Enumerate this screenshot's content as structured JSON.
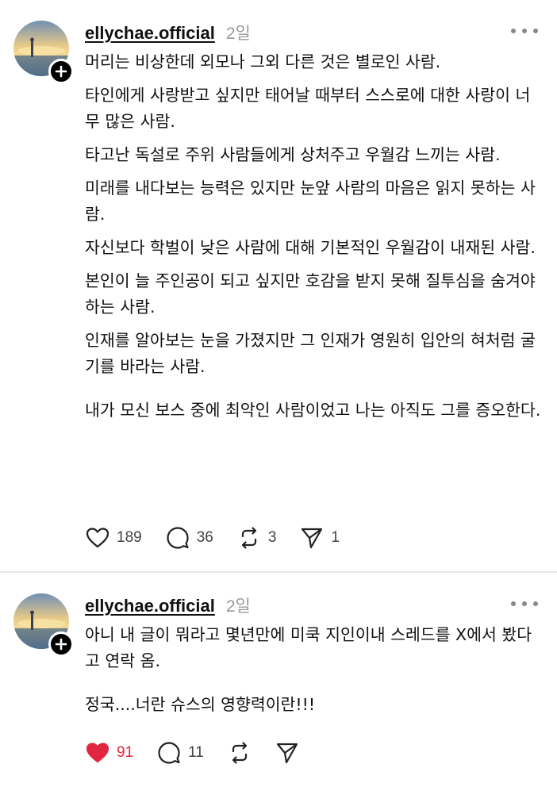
{
  "posts": [
    {
      "username": "ellychae.official",
      "time": "2일",
      "paragraphs": [
        "머리는 비상한데 외모나 그외 다른 것은 별로인 사람.",
        "타인에게 사랑받고 싶지만 태어날 때부터 스스로에 대한 사랑이 너무 많은 사람.",
        "타고난 독설로 주위 사람들에게 상처주고 우월감 느끼는 사람.",
        "미래를 내다보는 능력은 있지만 눈앞 사람의 마음은 읽지 못하는 사람.",
        "자신보다 학벌이 낮은 사람에 대해 기본적인 우월감이 내재된 사람.",
        "본인이 늘 주인공이 되고 싶지만 호감을 받지 못해 질투심을 숨겨야 하는 사람.",
        "인재를 알아보는 눈을 가졌지만 그 인재가 영원히 입안의 혀처럼 굴기를 바라는 사람.",
        "내가 모신 보스 중에 최악인 사람이었고 나는 아직도 그를 증오한다."
      ],
      "likes": "189",
      "replies": "36",
      "reposts": "3",
      "shares": "1",
      "liked": false
    },
    {
      "username": "ellychae.official",
      "time": "2일",
      "paragraphs": [
        "아니 내 글이 뭐라고 몇년만에 미쿡 지인이내 스레드를 X에서 봤다고 연락 옴.",
        "정국....너란 슈스의 영향력이란!!!"
      ],
      "likes": "91",
      "replies": "11",
      "liked": true
    }
  ],
  "icons": {
    "like": "heart-icon",
    "reply": "comment-bubble-icon",
    "repost": "repost-arrows-icon",
    "share": "send-paper-plane-icon",
    "more": "more-horizontal-icon",
    "follow": "plus-badge-icon"
  },
  "colors": {
    "liked": "#e3263f",
    "muted": "#9a9a9a",
    "text": "#101010"
  }
}
